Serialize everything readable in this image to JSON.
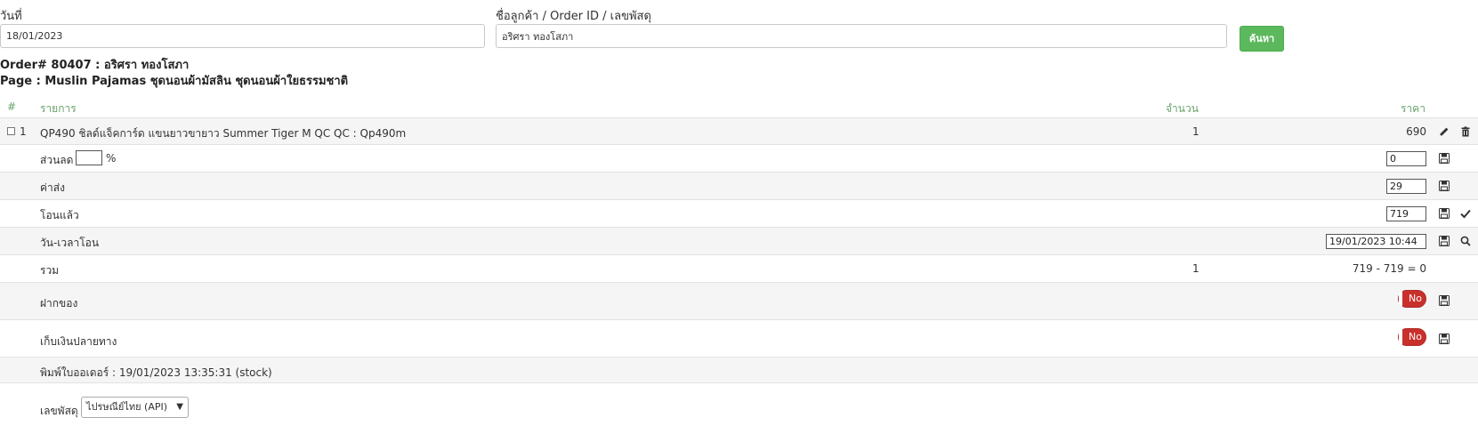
{
  "filters": {
    "date_label": "วันที่",
    "date_value": "18/01/2023",
    "customer_label": "ชื่อลูกค้า / Order ID / เลขพัสดุ",
    "customer_value": "อริศรา ทองโสภา",
    "search_button": "ค้นหา"
  },
  "order": {
    "title": "Order# 80407 : อริศรา ทองโสภา",
    "page_line": "Page : Muslin Pajamas ชุดนอนผ้ามัสลิน ชุดนอนผ้าใยธรรมชาติ"
  },
  "table": {
    "col_index": "#",
    "col_item": "รายการ",
    "col_qty": "จำนวน",
    "col_price": "ราคา",
    "items": [
      {
        "index": "1",
        "name": "QP490 ชิลด์แจ็คการ์ด แขนยาวขายาว Summer Tiger M QC QC : Qp490m",
        "qty": "1",
        "price": "690"
      }
    ],
    "discount": {
      "label": "ส่วนลด",
      "percent_value": "",
      "percent_sign": "%",
      "value": "0"
    },
    "shipping": {
      "label": "ค่าส่ง",
      "value": "29"
    },
    "paid": {
      "label": "โอนแล้ว",
      "value": "719"
    },
    "transfer_time": {
      "label": "วัน-เวลาโอน",
      "value": "19/01/2023 10:44"
    },
    "total": {
      "label": "รวม",
      "qty": "1",
      "formula": "719 - 719 = 0"
    },
    "deposit": {
      "label": "ฝากของ",
      "toggle": "No"
    },
    "cod": {
      "label": "เก็บเงินปลายทาง",
      "toggle": "No"
    },
    "printed": {
      "text": "พิมพ์ใบออเดอร์ : 19/01/2023 13:35:31 (stock)"
    },
    "tracking": {
      "label": "เลขพัสดุ",
      "selected": "ไปรษณีย์ไทย (API)"
    }
  },
  "colors": {
    "accent": "#5cb85c",
    "header_text": "#6aa36a",
    "toggle_off": "#c9302c"
  }
}
